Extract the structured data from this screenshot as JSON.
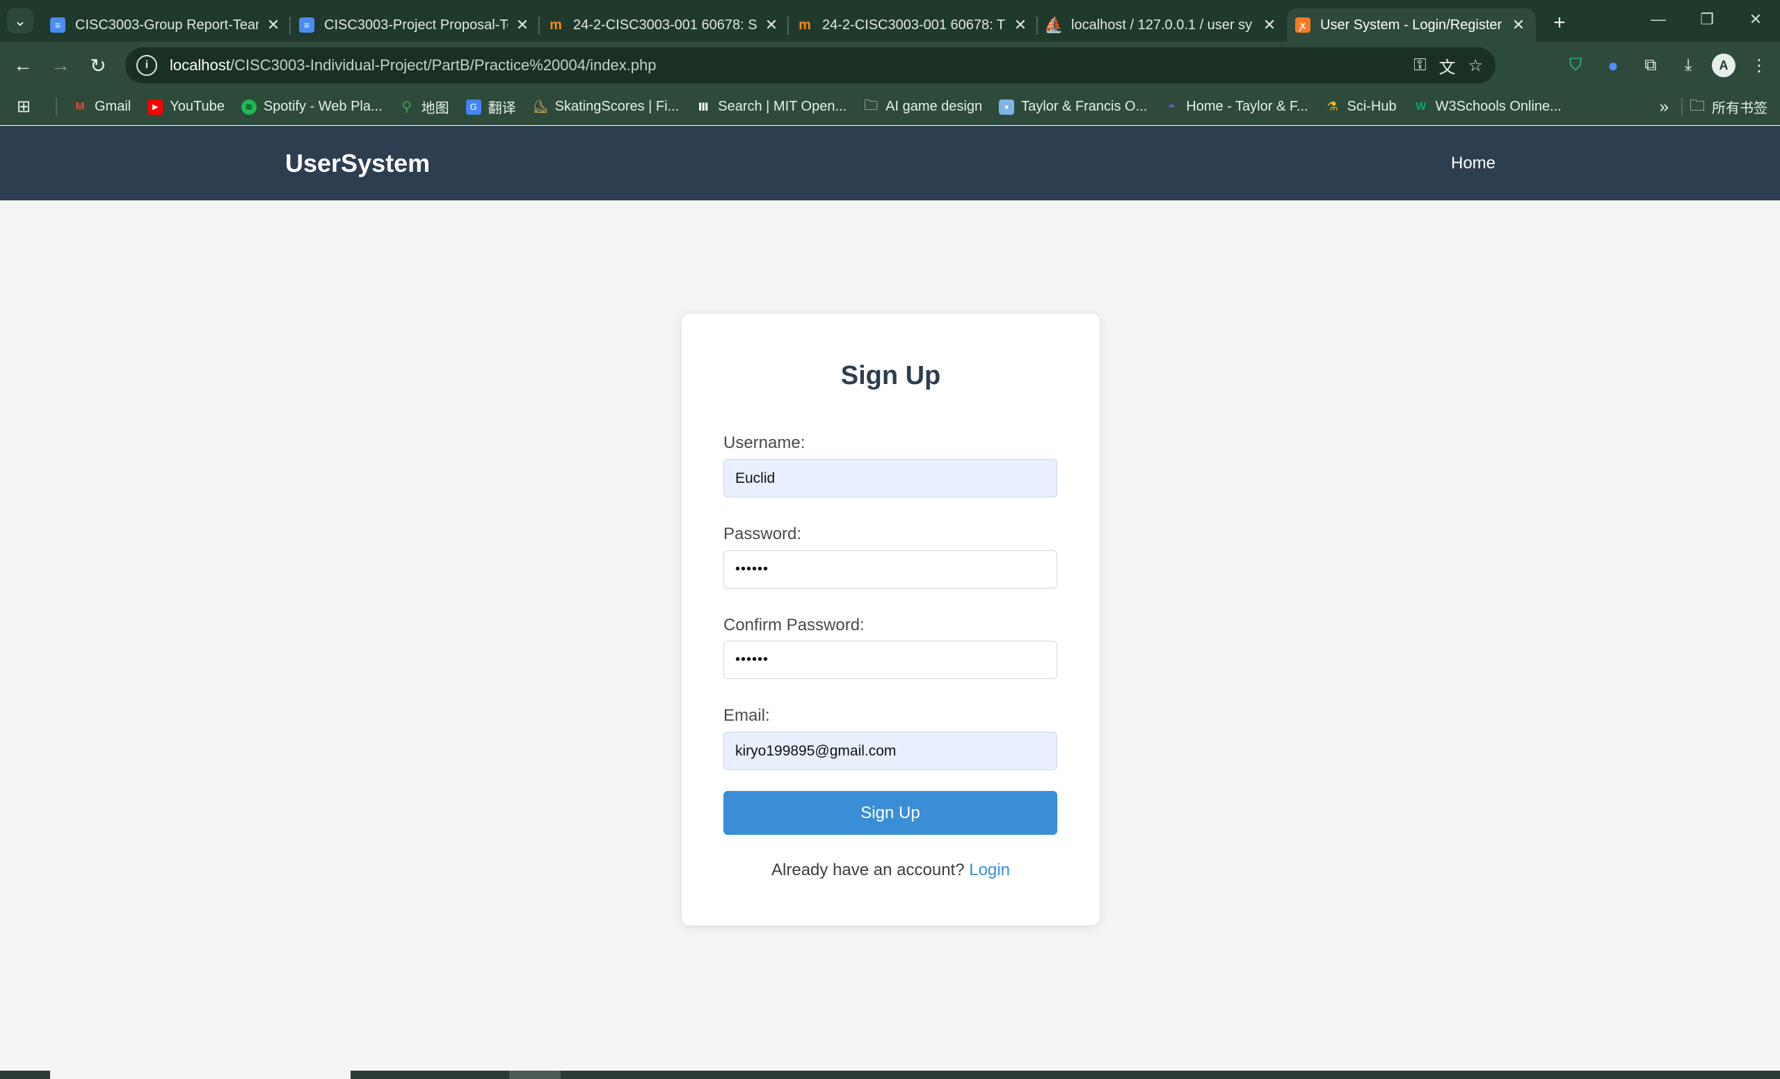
{
  "browser": {
    "tabs": [
      {
        "icon": "google-docs-icon",
        "title": "CISC3003-Group Report-Team"
      },
      {
        "icon": "google-docs-icon",
        "title": "CISC3003-Project Proposal-Te"
      },
      {
        "icon": "moodle-icon",
        "title": "24-2-CISC3003-001 60678: S"
      },
      {
        "icon": "moodle-icon",
        "title": "24-2-CISC3003-001 60678: T"
      },
      {
        "icon": "phpmyadmin-icon",
        "title": "localhost / 127.0.0.1 / user sy"
      },
      {
        "icon": "xampp-icon",
        "title": "User System - Login/Register"
      }
    ],
    "active_tab_index": 5,
    "url_host": "localhost",
    "url_path": "/CISC3003-Individual-Project/PartB/Practice%20004/index.php",
    "bookmarks": [
      {
        "icon": "gmail-icon",
        "label": "Gmail",
        "color": "#ea4335"
      },
      {
        "icon": "youtube-icon",
        "label": "YouTube",
        "color": "#ff0000"
      },
      {
        "icon": "spotify-icon",
        "label": "Spotify - Web Pla...",
        "color": "#1db954"
      },
      {
        "icon": "maps-icon",
        "label": "地图",
        "color": "#34a853"
      },
      {
        "icon": "translate-icon",
        "label": "翻译",
        "color": "#4285f4"
      },
      {
        "icon": "skating-icon",
        "label": "SkatingScores | Fi...",
        "color": "#e0b060"
      },
      {
        "icon": "mit-icon",
        "label": "Search | MIT Open...",
        "color": "#ffffff"
      },
      {
        "icon": "folder-icon",
        "label": "AI game design",
        "color": "#e6efe9"
      },
      {
        "icon": "taylor-francis-icon",
        "label": "Taylor & Francis O...",
        "color": "#7fb2e5"
      },
      {
        "icon": "taylor-home-icon",
        "label": "Home - Taylor & F...",
        "color": "#6b5bd6"
      },
      {
        "icon": "scihub-icon",
        "label": "Sci-Hub",
        "color": "#f2b41c"
      },
      {
        "icon": "w3schools-icon",
        "label": "W3Schools Online...",
        "color": "#04aa6d"
      }
    ],
    "all_bookmarks_label": "所有书签"
  },
  "site": {
    "brand": "UserSystem",
    "nav_home": "Home"
  },
  "form": {
    "title": "Sign Up",
    "username_label": "Username:",
    "username_value": "Euclid",
    "password_label": "Password:",
    "password_value": "••••••",
    "confirm_label": "Confirm Password:",
    "confirm_value": "••••••",
    "email_label": "Email:",
    "email_value": "kiryo199895@gmail.com",
    "submit_label": "Sign Up",
    "footer_prompt": "Already have an account? ",
    "footer_link": "Login"
  },
  "colors": {
    "header_bg": "#2d3e50",
    "accent": "#3a8ed6",
    "browser_chrome": "#2d4a3b"
  }
}
